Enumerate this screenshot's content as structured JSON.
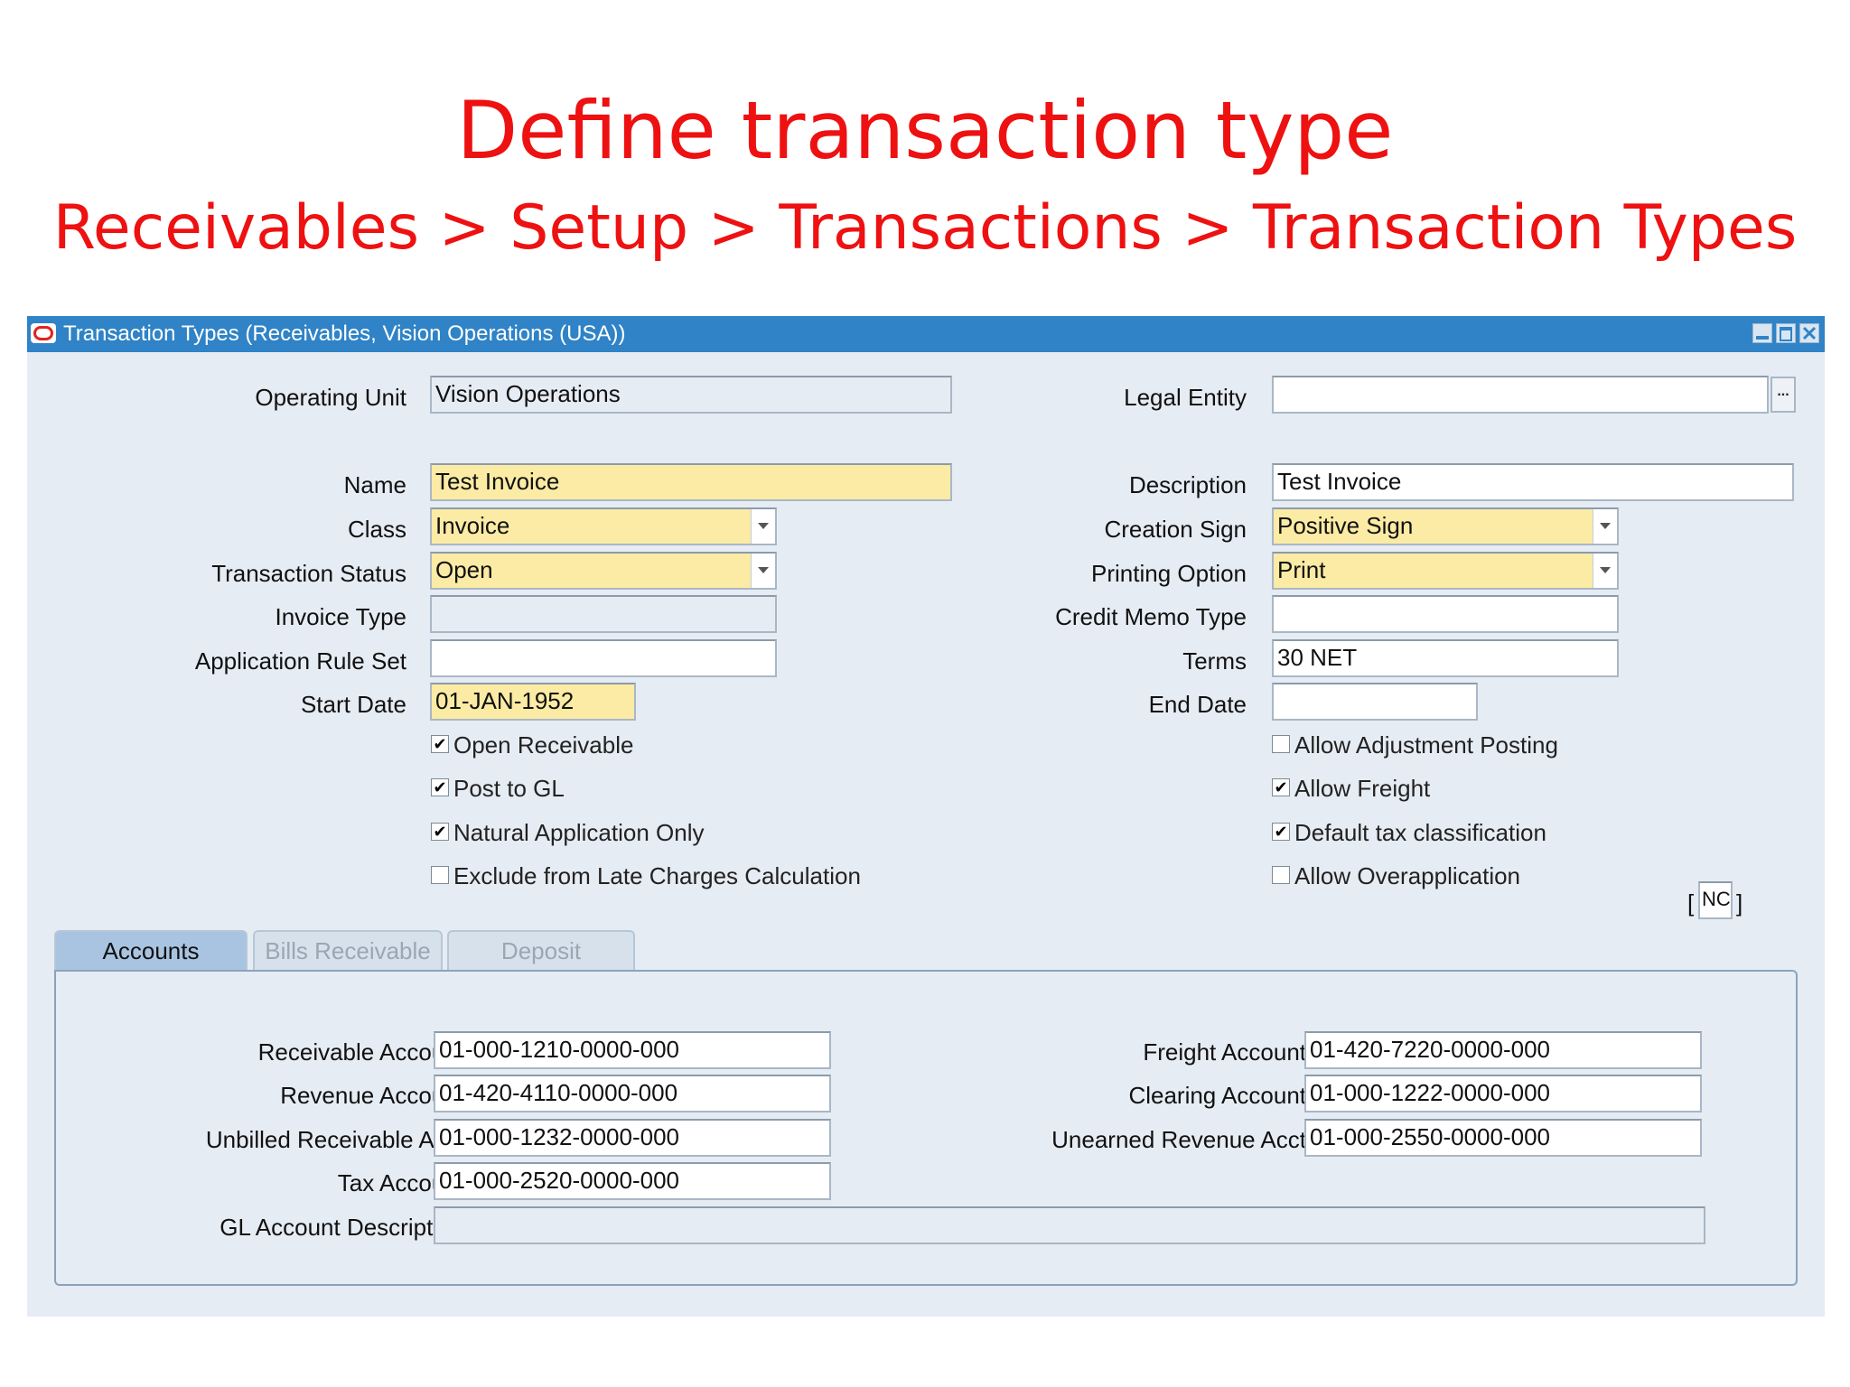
{
  "slide": {
    "title": "Define transaction type",
    "subtitle": "Receivables > Setup > Transactions > Transaction Types"
  },
  "window": {
    "title": "Transaction Types (Receivables, Vision Operations (USA))"
  },
  "form": {
    "operating_unit": {
      "label": "Operating Unit",
      "value": "Vision Operations"
    },
    "legal_entity": {
      "label": "Legal Entity",
      "value": ""
    },
    "name": {
      "label": "Name",
      "value": "Test Invoice"
    },
    "description": {
      "label": "Description",
      "value": "Test Invoice"
    },
    "class": {
      "label": "Class",
      "value": "Invoice"
    },
    "creation_sign": {
      "label": "Creation Sign",
      "value": "Positive Sign"
    },
    "transaction_status": {
      "label": "Transaction Status",
      "value": "Open"
    },
    "printing_option": {
      "label": "Printing Option",
      "value": "Print"
    },
    "invoice_type": {
      "label": "Invoice Type",
      "value": ""
    },
    "credit_memo_type": {
      "label": "Credit Memo Type",
      "value": ""
    },
    "application_rule_set": {
      "label": "Application Rule Set",
      "value": ""
    },
    "terms": {
      "label": "Terms",
      "value": "30 NET"
    },
    "start_date": {
      "label": "Start Date",
      "value": "01-JAN-1952"
    },
    "end_date": {
      "label": "End Date",
      "value": ""
    }
  },
  "checkboxes": {
    "left": [
      {
        "label": "Open Receivable",
        "checked": true
      },
      {
        "label": "Post to GL",
        "checked": true
      },
      {
        "label": "Natural Application Only",
        "checked": true
      },
      {
        "label": "Exclude from Late Charges Calculation",
        "checked": false
      }
    ],
    "right": [
      {
        "label": "Allow Adjustment Posting",
        "checked": false
      },
      {
        "label": "Allow Freight",
        "checked": true
      },
      {
        "label": "Default tax classification",
        "checked": true
      },
      {
        "label": "Allow Overapplication",
        "checked": false
      }
    ],
    "check_mark": "✔"
  },
  "flex_field": {
    "open": "[",
    "value": "NC",
    "close": "]"
  },
  "tabs": [
    {
      "label": "Accounts",
      "active": true
    },
    {
      "label": "Bills Receivable",
      "active": false
    },
    {
      "label": "Deposit",
      "active": false
    }
  ],
  "accounts": {
    "receivable": {
      "label": "Receivable Account",
      "value": "01-000-1210-0000-000"
    },
    "revenue": {
      "label": "Revenue Account",
      "value": "01-420-4110-0000-000"
    },
    "unbilled": {
      "label": "Unbilled Receivable Acct",
      "value": "01-000-1232-0000-000"
    },
    "tax": {
      "label": "Tax Account",
      "value": "01-000-2520-0000-000"
    },
    "freight": {
      "label": "Freight Account",
      "value": "01-420-7220-0000-000"
    },
    "clearing": {
      "label": "Clearing Account",
      "value": "01-000-1222-0000-000"
    },
    "unearned": {
      "label": "Unearned Revenue Acct",
      "value": "01-000-2550-0000-000"
    },
    "gl_description": {
      "label": "GL Account Description",
      "value": ""
    }
  },
  "icons": {
    "window_logo": "oracle-logo-icon",
    "minimize": "minimize-icon",
    "maximize": "maximize-icon",
    "close": "close-icon",
    "lov": "ellipsis-icon",
    "dropdown": "chevron-down-icon"
  },
  "lov_glyph": "...",
  "colors": {
    "title_red": "#ee1111",
    "titlebar_blue": "#2f83c6",
    "required_yellow": "#fbeba4",
    "window_bg": "#e6ecf3"
  }
}
